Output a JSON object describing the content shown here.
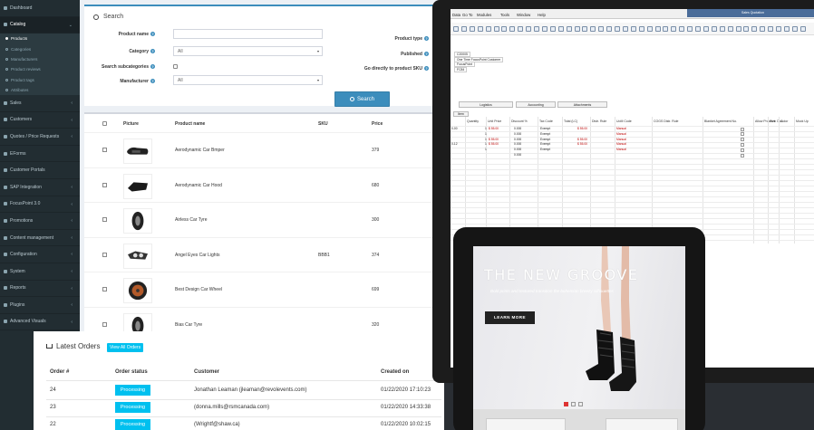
{
  "sidebar": {
    "items": [
      {
        "label": "Dashboard",
        "icon": "dashboard-icon",
        "chev": ""
      },
      {
        "label": "Catalog",
        "icon": "catalog-icon",
        "chev": "⌄",
        "active": true
      },
      {
        "label": "Sales",
        "icon": "cart-icon",
        "chev": "‹"
      },
      {
        "label": "Customers",
        "icon": "user-icon",
        "chev": "‹"
      },
      {
        "label": "Quotes / Price Requests",
        "icon": "quote-icon",
        "chev": "‹"
      },
      {
        "label": "EForms",
        "icon": "form-icon",
        "chev": ""
      },
      {
        "label": "Customer Portals",
        "icon": "portal-icon",
        "chev": ""
      },
      {
        "label": "SAP Integration",
        "icon": "sap-icon",
        "chev": "‹"
      },
      {
        "label": "FocusPoint 3.0",
        "icon": "focus-icon",
        "chev": "‹"
      },
      {
        "label": "Promotions",
        "icon": "tag-icon",
        "chev": "‹"
      },
      {
        "label": "Content management",
        "icon": "content-icon",
        "chev": "‹"
      },
      {
        "label": "Configuration",
        "icon": "gear-icon",
        "chev": "‹"
      },
      {
        "label": "System",
        "icon": "cube-icon",
        "chev": "‹"
      },
      {
        "label": "Reports",
        "icon": "chart-icon",
        "chev": "‹"
      },
      {
        "label": "Plugins",
        "icon": "plug-icon",
        "chev": "‹"
      },
      {
        "label": "Advanced Visuals",
        "icon": "visual-icon",
        "chev": "‹"
      }
    ],
    "catalog_sub": [
      "Products",
      "Categories",
      "Manufacturers",
      "Product reviews",
      "Product tags",
      "Attributes"
    ]
  },
  "search": {
    "title": "Search",
    "product_name_label": "Product name",
    "category_label": "Category",
    "category_value": "All",
    "search_subcategories_label": "Search subcategories",
    "manufacturer_label": "Manufacturer",
    "manufacturer_value": "All",
    "product_type_label": "Product type",
    "published_label": "Published",
    "goto_sku_label": "Go directly to product SKU",
    "button": "Search"
  },
  "grid": {
    "headers": {
      "picture": "Picture",
      "name": "Product name",
      "sku": "SKU",
      "price": "Price"
    },
    "rows": [
      {
        "name": "Aerodynamic Car Bmper",
        "sku": "",
        "price": "379",
        "img": "bumper"
      },
      {
        "name": "Aerodynamic Car Hood",
        "sku": "",
        "price": "680",
        "img": "hood"
      },
      {
        "name": "Airless Car Tyre",
        "sku": "",
        "price": "300",
        "img": "tyre"
      },
      {
        "name": "Angel Eyes Car Lights",
        "sku": "BBB1",
        "price": "374",
        "img": "lights"
      },
      {
        "name": "Best Design Car Wheel",
        "sku": "",
        "price": "699",
        "img": "wheel"
      },
      {
        "name": "Bias Car Tyre",
        "sku": "",
        "price": "320",
        "img": "tyre"
      }
    ]
  },
  "orders": {
    "title": "Latest Orders",
    "view_all": "View All Orders",
    "headers": {
      "num": "Order #",
      "status": "Order status",
      "customer": "Customer",
      "created": "Created on"
    },
    "rows": [
      {
        "num": "24",
        "status": "Processing",
        "customer": "Jonathan Leaman (jleaman@revolevents.com)",
        "created": "01/22/2020 17:10:23"
      },
      {
        "num": "23",
        "status": "Processing",
        "customer": "(donna.mills@rsmcanada.com)",
        "created": "01/22/2020 14:33:38"
      },
      {
        "num": "22",
        "status": "Processing",
        "customer": "(Wrightf@shaw.ca)",
        "created": "01/22/2020 10:02:15"
      }
    ]
  },
  "erp": {
    "menu": [
      "Data",
      "Go To",
      "Modules",
      "Tools",
      "Window",
      "Help"
    ],
    "window_title": "Sales Quotation",
    "fields": [
      "C20005",
      "One Time FocusPoint Customer",
      "FocusPoint",
      "FC84"
    ],
    "tabs": [
      "Logistics",
      "Accounting",
      "Attachments"
    ],
    "item_tab": "Item",
    "columns": [
      "Quantity",
      "Unit Price",
      "Discount %",
      "Tax Code",
      "Total (LC)",
      "Distr. Rule",
      "UoM Code",
      "COGS Distr. Rule",
      "Blanket Agreement No.",
      "Allow Procmnt. Doc.",
      "Size",
      "Color",
      "Mock Up"
    ],
    "rows": [
      {
        "code": "0-00",
        "qty": "1",
        "price": "$ 55.00",
        "disc": "0.000",
        "tax": "Exempt",
        "total": "$ 55.00",
        "uom": "Manual"
      },
      {
        "code": "",
        "qty": "1",
        "price": "",
        "disc": "0.000",
        "tax": "Exempt",
        "total": "",
        "uom": "Manual"
      },
      {
        "code": "",
        "qty": "1",
        "price": "$ 55.00",
        "disc": "0.000",
        "tax": "Exempt",
        "total": "$ 55.00",
        "uom": "Manual"
      },
      {
        "code": "0-12",
        "qty": "1",
        "price": "$ 55.00",
        "disc": "0.000",
        "tax": "Exempt",
        "total": "$ 55.00",
        "uom": "Manual"
      },
      {
        "code": "",
        "qty": "1",
        "price": "",
        "disc": "0.000",
        "tax": "Exempt",
        "total": "",
        "uom": "Manual"
      },
      {
        "code": "",
        "qty": "",
        "price": "",
        "disc": "0.000",
        "tax": "",
        "total": "",
        "uom": ""
      }
    ]
  },
  "tablet": {
    "headline": "THE NEW GROOVE",
    "subline": "Bold prints and textured transition the bohemian breezy silhouettes",
    "button": "LEARN MORE"
  }
}
